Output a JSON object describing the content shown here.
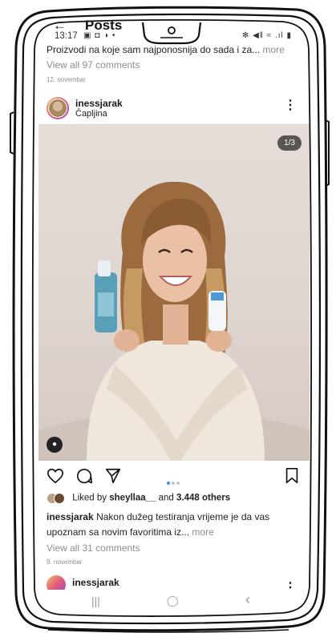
{
  "status_bar": {
    "time": "13:17",
    "left_icons": "▣ ◘ ◑ •",
    "right_icons": "✻ ◀‖ ≈ .ıl ▮"
  },
  "header": {
    "title": "Posts",
    "back_icon": "back-arrow-icon"
  },
  "previous_post": {
    "caption": "Proizvodi na koje sam najponosnija do sada i za...",
    "more_label": "more",
    "view_comments": "View all 97 comments",
    "date": "12. novembar"
  },
  "post": {
    "username": "inessjarak",
    "location": "Čapljina",
    "image_counter": "1/3",
    "carousel": {
      "total": 3,
      "current": 1
    },
    "liked_by_prefix": "Liked by",
    "liked_by_user": "sheyllaa__",
    "liked_by_and": "and",
    "liked_by_count": "3.448 others",
    "caption_user": "inessjarak",
    "caption_text": "Nakon dužeg testiranja vrijeme je da vas upoznam sa novim favoritima iz...",
    "caption_more": "more",
    "view_comments": "View all 31 comments",
    "date": "9. novembar"
  },
  "next_post": {
    "username": "inessjarak"
  },
  "nav_bar": {
    "recents": "|||",
    "home": "◯",
    "back": "‹"
  },
  "colors": {
    "accent_blue": "#3897f0",
    "muted_text": "#8e8e8e",
    "text": "#222222"
  }
}
